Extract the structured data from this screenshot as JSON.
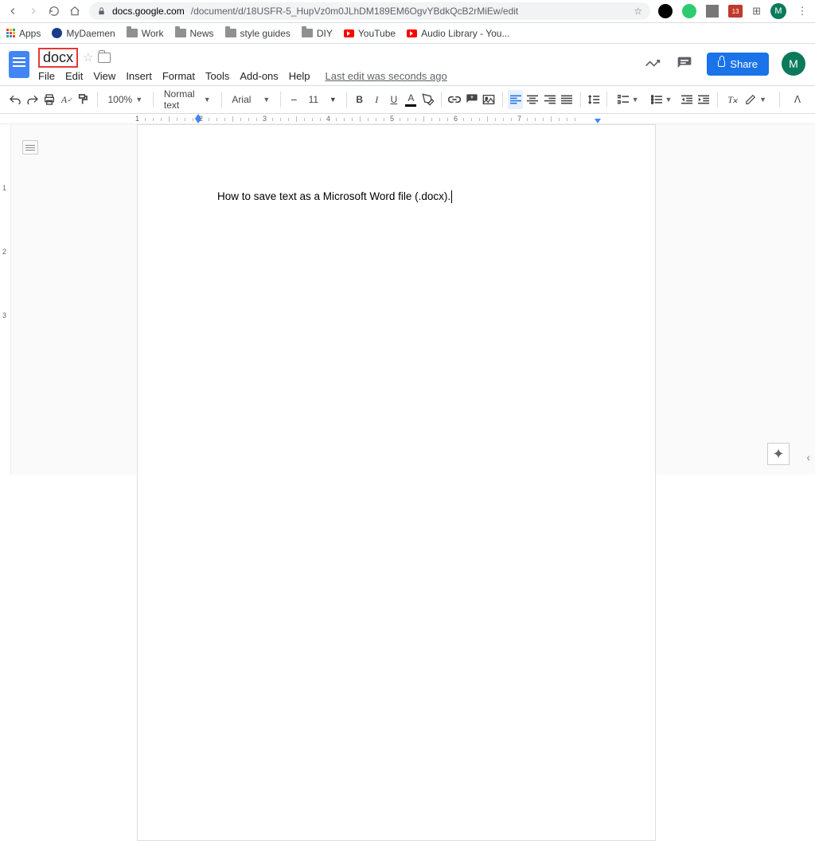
{
  "chrome": {
    "url_host": "docs.google.com",
    "url_path": "/document/d/18USFR-5_HupVz0m0JLhDM189EM6OgvYBdkQcB2rMiEw/edit",
    "avatar_initial": "M",
    "ext_badge": "13"
  },
  "bookmarks": {
    "apps": "Apps",
    "items": [
      "MyDaemen",
      "Work",
      "News",
      "style guides",
      "DIY",
      "YouTube",
      "Audio Library - You..."
    ]
  },
  "doc": {
    "title": "docx",
    "menus": [
      "File",
      "Edit",
      "View",
      "Insert",
      "Format",
      "Tools",
      "Add-ons",
      "Help"
    ],
    "last_edit": "Last edit was seconds ago",
    "share_label": "Share",
    "body_text": "How to save text as a Microsoft Word file (.docx).",
    "avatar_initial": "M"
  },
  "toolbar": {
    "zoom": "100%",
    "style": "Normal text",
    "font": "Arial",
    "size": "11"
  },
  "ruler": {
    "numbers": [
      "1",
      "2",
      "3",
      "4",
      "5",
      "6",
      "7"
    ]
  },
  "vruler": {
    "numbers": [
      "1",
      "2",
      "3"
    ]
  }
}
